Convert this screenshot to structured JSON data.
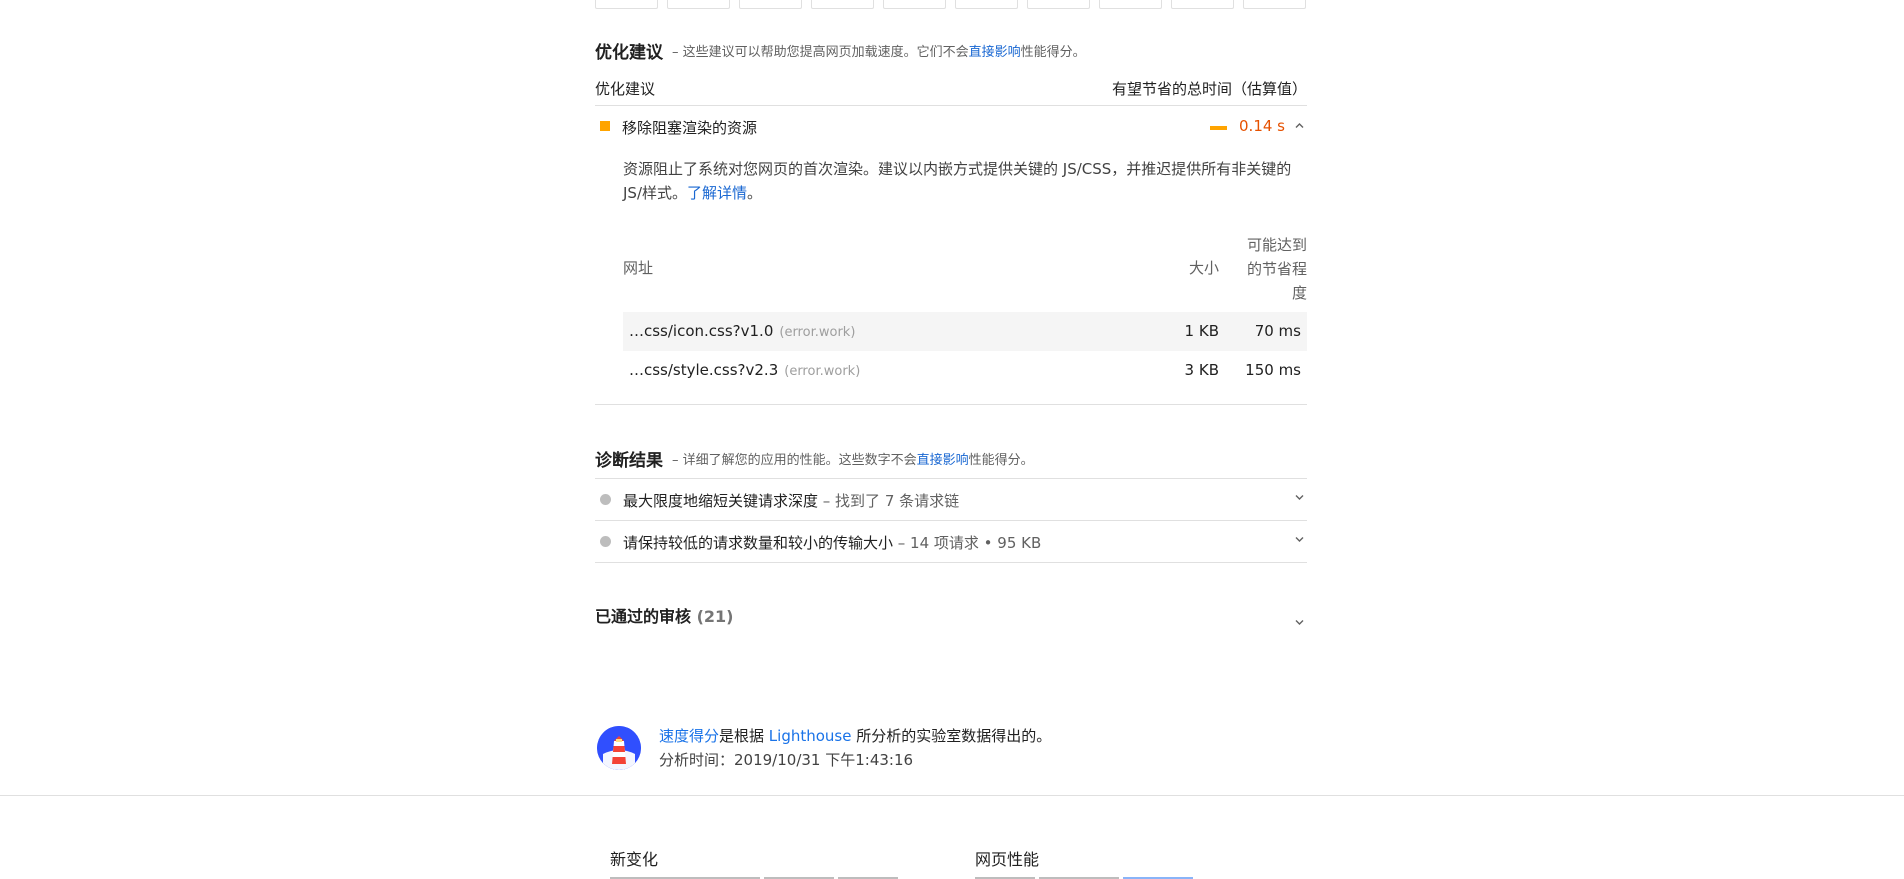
{
  "opportunities": {
    "title": "优化建议",
    "desc_prefix": "– 这些建议可以帮助您提高网页加载速度。它们不会",
    "desc_link": "直接影响",
    "desc_suffix": "性能得分。",
    "col_left": "优化建议",
    "col_right": "有望节省的总时间（估算值）",
    "audit": {
      "title": "移除阻塞渲染的资源",
      "value": "0.14 s",
      "description_text": "资源阻止了系统对您网页的首次渲染。建议以内嵌方式提供关键的 JS/CSS，并推迟提供所有非关键的 JS/样式。",
      "description_link": "了解详情",
      "description_end": "。",
      "table": {
        "header_url": "网址",
        "header_size": "大小",
        "header_savings": "可能达到的节省程度",
        "rows": [
          {
            "url": "…css/icon.css?v1.0",
            "host": "(error.work)",
            "size": "1 KB",
            "savings": "70 ms"
          },
          {
            "url": "…css/style.css?v2.3",
            "host": "(error.work)",
            "size": "3 KB",
            "savings": "150 ms"
          }
        ]
      }
    }
  },
  "diagnostics": {
    "title": "诊断结果",
    "desc_prefix": "– 详细了解您的应用的性能。这些数字不会",
    "desc_link": "直接影响",
    "desc_suffix": "性能得分。",
    "items": [
      {
        "title": "最大限度地缩短关键请求深度",
        "sub": " – 找到了 7 条请求链"
      },
      {
        "title": "请保持较低的请求数量和较小的传输大小",
        "sub": " – 14 项请求 • 95 KB"
      }
    ]
  },
  "passed": {
    "title": "已通过的审核",
    "count": "(21)"
  },
  "footer": {
    "link1": "速度得分",
    "text1": "是根据 ",
    "link2": "Lighthouse",
    "text2": " 所分析的实验室数据得出的。",
    "analyzed": "分析时间：2019/10/31 下午1:43:16"
  },
  "bottom": {
    "col1_title": "新变化",
    "col2_title": "网页性能"
  },
  "colors": {
    "average": "#ffa400",
    "average_text": "#e65100",
    "link": "#1a73e8",
    "neutral": "#bdbdbd"
  }
}
